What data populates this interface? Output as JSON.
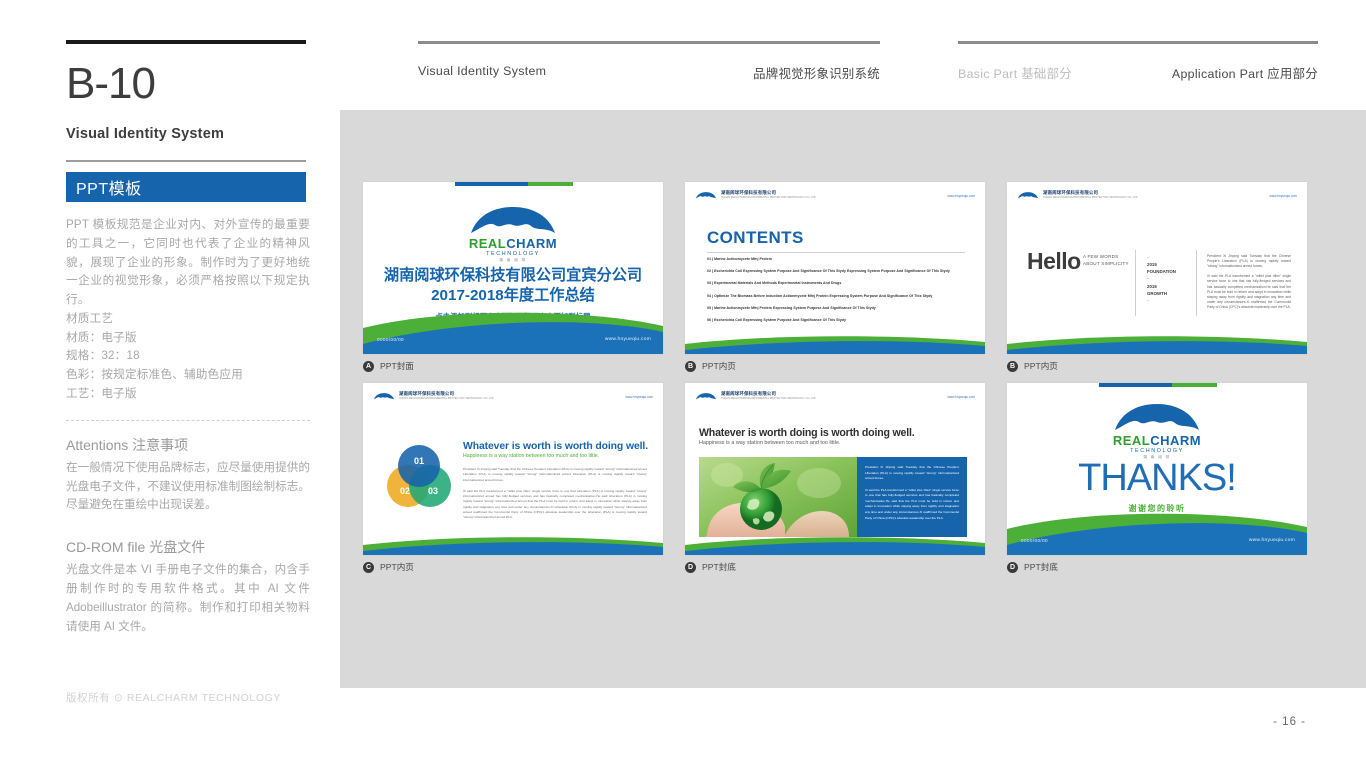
{
  "left": {
    "code": "B-10",
    "code_sub": "Visual Identity System",
    "section_title": "PPT模板",
    "body_paragraph": "PPT 模板规范是企业对内、对外宣传的最重要的工具之一，它同时也代表了企业的精神风貌，展现了企业的形象。制作时为了更好地统一企业的视觉形象，必须严格按照以下规定执行。",
    "spec_lines": [
      "材质工艺",
      "材质：电子版",
      "规格：32：18",
      "色彩：按规定标准色、辅助色应用",
      "工艺：电子版"
    ],
    "attentions_heading": "Attentions 注意事项",
    "attentions_body": "在一般情况下使用品牌标志，应尽量使用提供的光盘电子文件，不建议使用标准制图绘制标志。尽量避免在重绘中出现误差。",
    "cdrom_heading": "CD-ROM file 光盘文件",
    "cdrom_body": "光盘文件是本 VI 手册电子文件的集合，内含手册制作时的专用软件格式。其中 AI 文件 Adobeillustrator 的简称。制作和打印相关物料请使用 AI 文件。",
    "footer_copyright": "版权所有 ⊙ REALCHARM TECHNOLOGY",
    "page_number": "- 16 -"
  },
  "nav": {
    "item_en_1": "Visual Identity System",
    "item_cn_1": "品牌视觉形象识别系统",
    "item_basic": "Basic Part 基础部分",
    "item_application": "Application Part 应用部分"
  },
  "brand": {
    "logo_name_part1": "REAL",
    "logo_name_part2": "CHARM",
    "logo_tagline": "TECHNOLOGY",
    "logo_cn_small": "湖 南 阅 球",
    "header_company_cn": "湖南阅球环保科技有限公司",
    "header_company_en": "HUNAN REALCHARM ENVIRONMENTAL PROTECTION TECHNOLOGY CO.,LTD",
    "website": "www.hnyueqiu.com",
    "date_placeholder": "0000/00/00"
  },
  "colors": {
    "brand_blue": "#1664ab",
    "brand_green": "#4caf37",
    "accent_yellow": "#efaa22",
    "accent_teal": "#22a877",
    "canvas_grey": "#d9d9d9"
  },
  "slides": [
    {
      "id": "cover",
      "badge": "A",
      "caption": "PPT封面",
      "title_line1": "湖南阅球环保科技有限公司宜宾分公司",
      "title_line2": "2017-2018年度工作总结",
      "subtitle": "点击添加副标题点击添加副标题点击添加副标题"
    },
    {
      "id": "contents",
      "badge": "B",
      "caption": "PPT内页",
      "heading": "CONTENTS",
      "items": [
        "01 | Marine Actinomycete Mfnj Protein",
        "02 | Escherichia Coli Expressing System Purpose And Significance Of This Stydy Expressing System Purpose And Significance Of This Stydy",
        "03 | Experimental Materials And Methods Experimental Instruments And Drugs",
        "04 | Optimize The Biomass Before Induction Actionmycete Mfnj Protein Expressing System Purpose And Significance Of This Stydy",
        "05 | Marine Actionmycete Mfnj Protein Expressing System Purpose And Significance Of This Stydy",
        "06 | Escherichia Coli Expressing System Purpose And Significance Of This Stydy"
      ]
    },
    {
      "id": "hello",
      "badge": "B",
      "caption": "PPT内页",
      "word": "Hello",
      "subtitle": "A FEW WORDS ABOUT SIMPLICITY",
      "timeline": [
        "–",
        "2015",
        "FOUNDATION",
        "–",
        "2016",
        "GROWTH",
        "–"
      ],
      "body_p1": "President Xi Jinping said Tuesday that the Chinese People's Liberation (PLA) is moving rapidly toward \"strong\" informationized armed forces.",
      "body_p2": "Xi said the PLA transformed a \"millet plus rifles\" single service force to one that has fully-fledged services and has basically completed mechanization.He said that the PLA must be bold in reform and adept in innovation while staying away from rigidity and stagnation any time and under any circumstances.Xi reaffirmed the Communist Party of China (CPC)'s absolute leadership over the PLA."
    },
    {
      "id": "venn",
      "badge": "C",
      "caption": "PPT内页",
      "title": "Whatever is worth is worth doing well.",
      "subtitle": "Happiness is a way station between too much and too little.",
      "circles": [
        "01",
        "02",
        "03"
      ],
      "body_p1": "President Xi Jinping said Tuesday that the Chinese People's Liberation (PLA) is moving rapidly toward \"strong\" informationized armed Liberation (PLA) is moving rapidly toward \"strong\" informationized armed Liberation (PLA) is moving rapidly toward \"strong\" informationized armed forces.",
      "body_p2": "Xi said the PLA transformed a \"millet plus rifles\" single service force to one that Liberation (PLA) is moving rapidly toward \"strong\" informationized armed has fully-fledged services and has basically completed mechanization.He said Liberation (PLA) is moving rapidly toward \"strong\" informationized armed that the PLA must be bold in reform and adept in innovation while staying away from rigidity and stagnation any time and under any circumstances.Xi Liberation (PLA) is moving rapidly toward \"strong\" informationized armed reaffirmed the Communist Party of China (CPC)'s absolute leadership over the Liberation (PLA) is moving rapidly toward \"strong\" informationized armed PLA."
    },
    {
      "id": "photo",
      "badge": "D",
      "caption": "PPT封底",
      "title": "Whatever is worth doing is worth doing well.",
      "subtitle": "Happiness is a way station between too much and too little.",
      "image_alt": "hands-holding-green-globe-with-leaves",
      "body_p1": "President Xi Jinping said Tuesday that the Chinese People's Liberation (PLA) is moving rapidly toward \"strong\" informationized armed forces.",
      "body_p2": "Xi said the PLA transformed a \"millet plus rifles\" single service force to one that has fully-fledged services and has basically completed mechanization.He said that the PLA must be bold in reform and adept in innovation while staying away from rigidity and stagnation any time and under any circumstances.Xi reaffirmed the Communist Party of China (CPC)'s absolute leadership over the PLA."
    },
    {
      "id": "thanks",
      "badge": "D",
      "caption": "PPT封底",
      "word": "THANKS!",
      "word_cn": "谢谢您的聆听"
    }
  ]
}
